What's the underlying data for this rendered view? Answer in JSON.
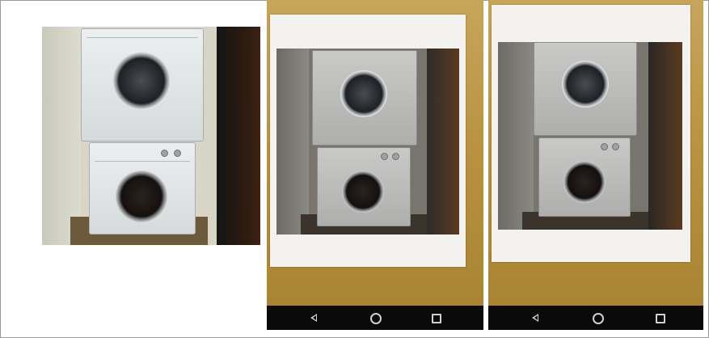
{
  "figure": {
    "panels": [
      {
        "name": "original-photo",
        "description_visible": false
      },
      {
        "name": "phone-capture-1",
        "nav_icons": [
          "back-icon",
          "home-icon",
          "recents-icon"
        ]
      },
      {
        "name": "phone-capture-2",
        "nav_icons": [
          "back-icon",
          "home-icon",
          "recents-icon"
        ]
      }
    ]
  },
  "colors": {
    "table": "#b8923f",
    "paper": "#f3f2ee",
    "navbar": "#0a0a0a"
  }
}
